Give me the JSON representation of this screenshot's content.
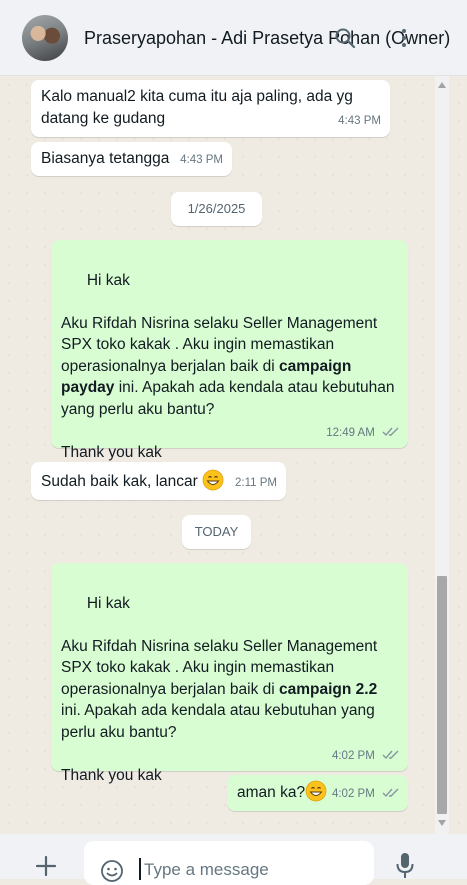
{
  "header": {
    "title": "Praseryapohan - Adi Prasetya Pohan (Owner)",
    "search_icon": "search-icon",
    "menu_icon": "kebab-menu-icon"
  },
  "messages": [
    {
      "direction": "in",
      "text": "Kalo manual2 kita cuma itu aja paling, ada yg\ndatang ke gudang",
      "time": "4:43 PM"
    },
    {
      "direction": "in",
      "text": "Biasanya tetangga",
      "time": "4:43 PM"
    },
    {
      "type": "date",
      "label": "1/26/2025"
    },
    {
      "direction": "out",
      "greeting": "Hi kak",
      "body_before": "Aku Rifdah Nisrina selaku Seller Management\nSPX toko kakak . Aku ingin memastikan\noperasionalnya berjalan baik di ",
      "bold": "campaign\npayday",
      "body_after": " ini. Apakah ada kendala atau kebutuhan\nyang perlu aku bantu?",
      "closing": "Thank you kak",
      "time": "12:49 AM",
      "status": "read"
    },
    {
      "direction": "in",
      "text": "Sudah baik kak, lancar",
      "emoji": "grinning-face-emoji",
      "time": "2:11 PM"
    },
    {
      "type": "date",
      "label": "TODAY"
    },
    {
      "direction": "out",
      "greeting": "Hi kak",
      "body_before": "Aku Rifdah Nisrina selaku Seller Management\nSPX toko kakak . Aku ingin memastikan\noperasionalnya berjalan baik di ",
      "bold": "campaign 2.2",
      "body_after": "\nini. Apakah ada kendala atau kebutuhan yang\nperlu aku bantu?",
      "closing": "Thank you kak",
      "time": "4:02 PM",
      "status": "read"
    },
    {
      "direction": "out",
      "text": "aman ka?",
      "emoji": "grinning-face-emoji",
      "time": "4:02 PM",
      "status": "read"
    }
  ],
  "composer": {
    "placeholder": "Type a message",
    "attach_icon": "plus-icon",
    "emoji_icon": "emoji-icon",
    "mic_icon": "mic-icon"
  },
  "colors": {
    "incoming": "#ffffff",
    "outgoing": "#d9fdd3",
    "background": "#efeae2",
    "read_ticks": "#8696a0"
  }
}
